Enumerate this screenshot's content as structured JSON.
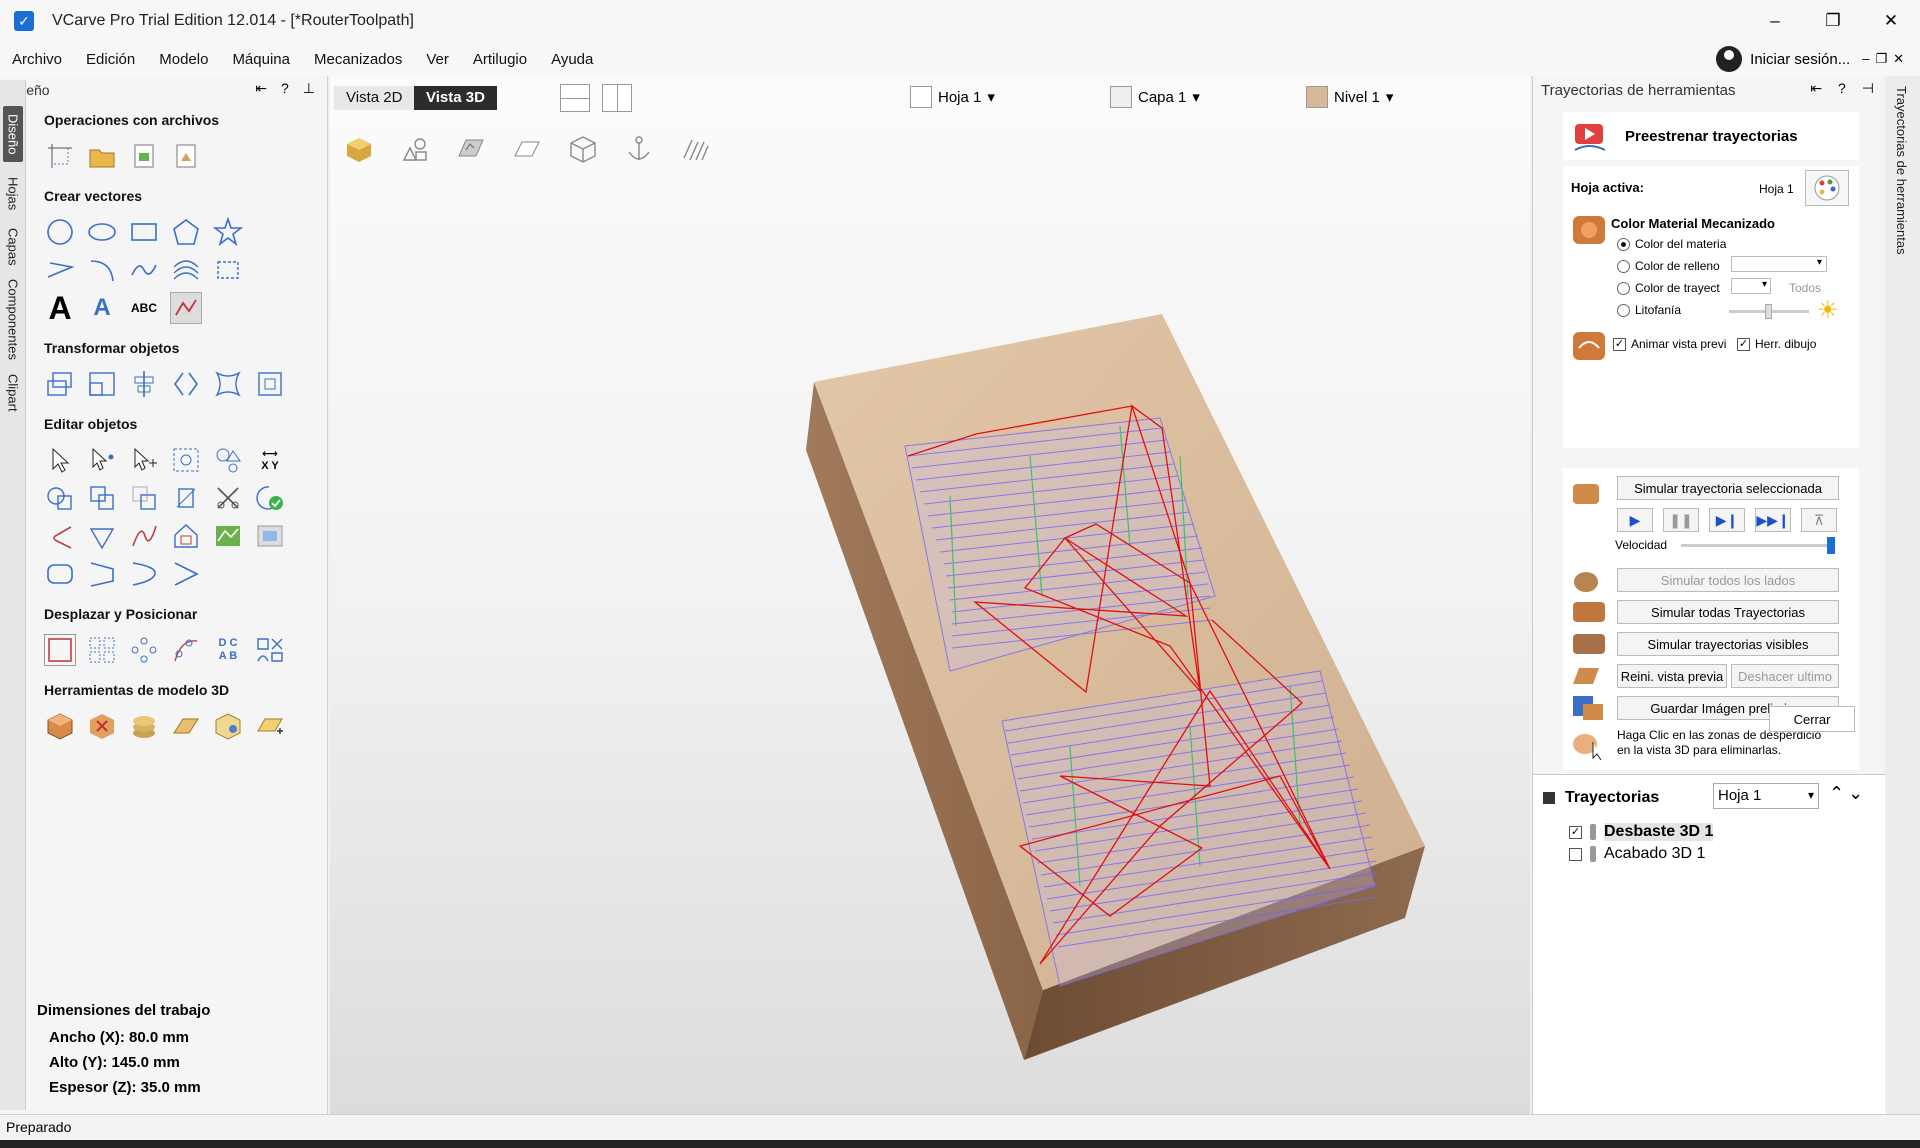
{
  "titlebar": {
    "title": "VCarve Pro Trial Edition 12.014 - [*RouterToolpath]",
    "minimize": "–",
    "restore": "❐",
    "close": "✕"
  },
  "menu": [
    "Archivo",
    "Edición",
    "Modelo",
    "Máquina",
    "Mecanizados",
    "Ver",
    "Artilugio",
    "Ayuda"
  ],
  "login": {
    "label": "Iniciar sesión..."
  },
  "left_tabs": [
    "Diseño",
    "Hojas",
    "Capas",
    "Componentes",
    "Clipart"
  ],
  "left_panel": {
    "header": "Diseño",
    "sections": [
      {
        "title": "Operaciones con archivos"
      },
      {
        "title": "Crear vectores"
      },
      {
        "title": "Transformar objetos"
      },
      {
        "title": "Editar objetos"
      },
      {
        "title": "Desplazar y Posicionar"
      },
      {
        "title": "Herramientas de modelo 3D"
      }
    ],
    "text_icons": {
      "big_a": "A",
      "outline_a": "A",
      "abc": "ABC",
      "xy": "X Y",
      "dc": "D C",
      "ab": "A B"
    },
    "dimensions": {
      "title": "Dimensiones del trabajo",
      "width": "Ancho   (X): 80.0 mm",
      "height": "Alto    (Y): 145.0 mm",
      "thickness": "Espesor (Z): 35.0 mm"
    }
  },
  "view_toolbar": {
    "view2d": "Vista 2D",
    "view3d": "Vista 3D",
    "sheet": "Hoja 1",
    "layer": "Capa 1",
    "level": "Nivel 1"
  },
  "right_panel": {
    "title": "Trayectorias de herramientas",
    "preview_title": "Preestrenar trayectorias",
    "active_sheet_label": "Hoja activa:",
    "active_sheet_value": "Hoja 1",
    "material_title": "Color Material Mecanizado",
    "opt_material": "Color del materia",
    "opt_fill": "Color de relleno",
    "opt_toolpath": "Color de trayect",
    "all": "Todos",
    "opt_lithophane": "Litofanía",
    "animate": "Animar vista previ",
    "draw_tool": "Herr. dibujo",
    "sim_selected": "Simular trayectoria seleccionada",
    "speed": "Velocidad",
    "sim_all_sides": "Simular todos los lados",
    "sim_all": "Simular todas Trayectorias",
    "sim_visible": "Simular trayectorias visibles",
    "reset_preview": "Reini. vista previa",
    "undo_last": "Deshacer ultimo",
    "save_image": "Guardar Imágen preliminar",
    "help_text_1": "Haga Clic en las zonas de desperdicio",
    "help_text_2": "en la vista 3D para eliminarlas.",
    "close": "Cerrar"
  },
  "toolpaths": {
    "title": "Trayectorias",
    "sheet": "Hoja 1",
    "items": [
      {
        "name": "Desbaste 3D 1",
        "checked": true
      },
      {
        "name": "Acabado 3D 1",
        "checked": false
      }
    ]
  },
  "right_vtab": "Trayectorias de herramientas",
  "status": "Preparado",
  "colors": {
    "accent": "#1a6fd6",
    "wood_top": "#d7b99a",
    "wood_side": "#9a7658",
    "toolpath_blue": "#7b6cf0",
    "rapid_red": "#e01010"
  }
}
